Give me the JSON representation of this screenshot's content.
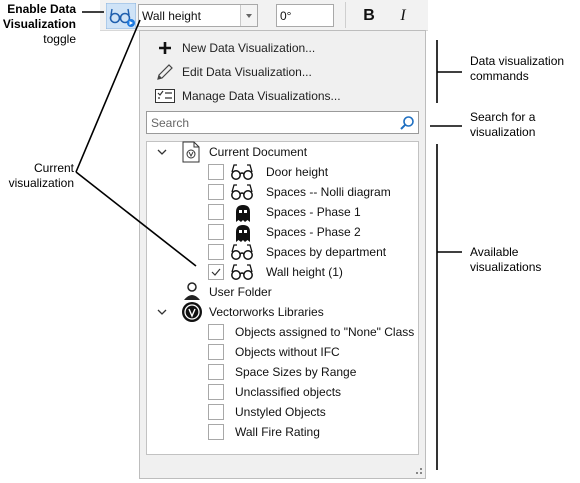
{
  "callouts": {
    "toggle_line1": "Enable Data",
    "toggle_line2": "Visualization",
    "toggle_line3": "toggle",
    "current_line1": "Current",
    "current_line2": "visualization",
    "commands_line1": "Data visualization",
    "commands_line2": "commands",
    "search_line1": "Search for a",
    "search_line2": "visualization",
    "available_line1": "Available",
    "available_line2": "visualizations"
  },
  "toolbar": {
    "current_visualization": "Wall height",
    "angle_value": "0°",
    "bold_label": "B",
    "italic_label": "I"
  },
  "commands": [
    {
      "label": "New Data Visualization...",
      "icon": "plus-icon"
    },
    {
      "label": "Edit Data Visualization...",
      "icon": "pencil-icon"
    },
    {
      "label": "Manage Data Visualizations...",
      "icon": "manage-list-icon"
    }
  ],
  "search": {
    "placeholder": "Search"
  },
  "tree": {
    "current_document": {
      "label": "Current Document",
      "items": [
        {
          "label": "Door height",
          "icon": "glasses-icon",
          "checked": false
        },
        {
          "label": "Spaces -- Nolli diagram",
          "icon": "glasses-icon",
          "checked": false
        },
        {
          "label": "Spaces - Phase 1",
          "icon": "ghost-icon",
          "checked": false
        },
        {
          "label": "Spaces - Phase 2",
          "icon": "ghost-icon",
          "checked": false
        },
        {
          "label": "Spaces by department",
          "icon": "glasses-icon",
          "checked": false
        },
        {
          "label": "Wall height (1)",
          "icon": "glasses-icon",
          "checked": true
        }
      ]
    },
    "user_folder": {
      "label": "User Folder"
    },
    "vectorworks_libraries": {
      "label": "Vectorworks Libraries",
      "items": [
        {
          "label": "Objects assigned to \"None\" Class",
          "checked": false
        },
        {
          "label": "Objects without IFC",
          "checked": false
        },
        {
          "label": "Space Sizes by Range",
          "checked": false
        },
        {
          "label": "Unclassified objects",
          "checked": false
        },
        {
          "label": "Unstyled Objects",
          "checked": false
        },
        {
          "label": "Wall Fire Rating",
          "checked": false
        }
      ]
    }
  }
}
